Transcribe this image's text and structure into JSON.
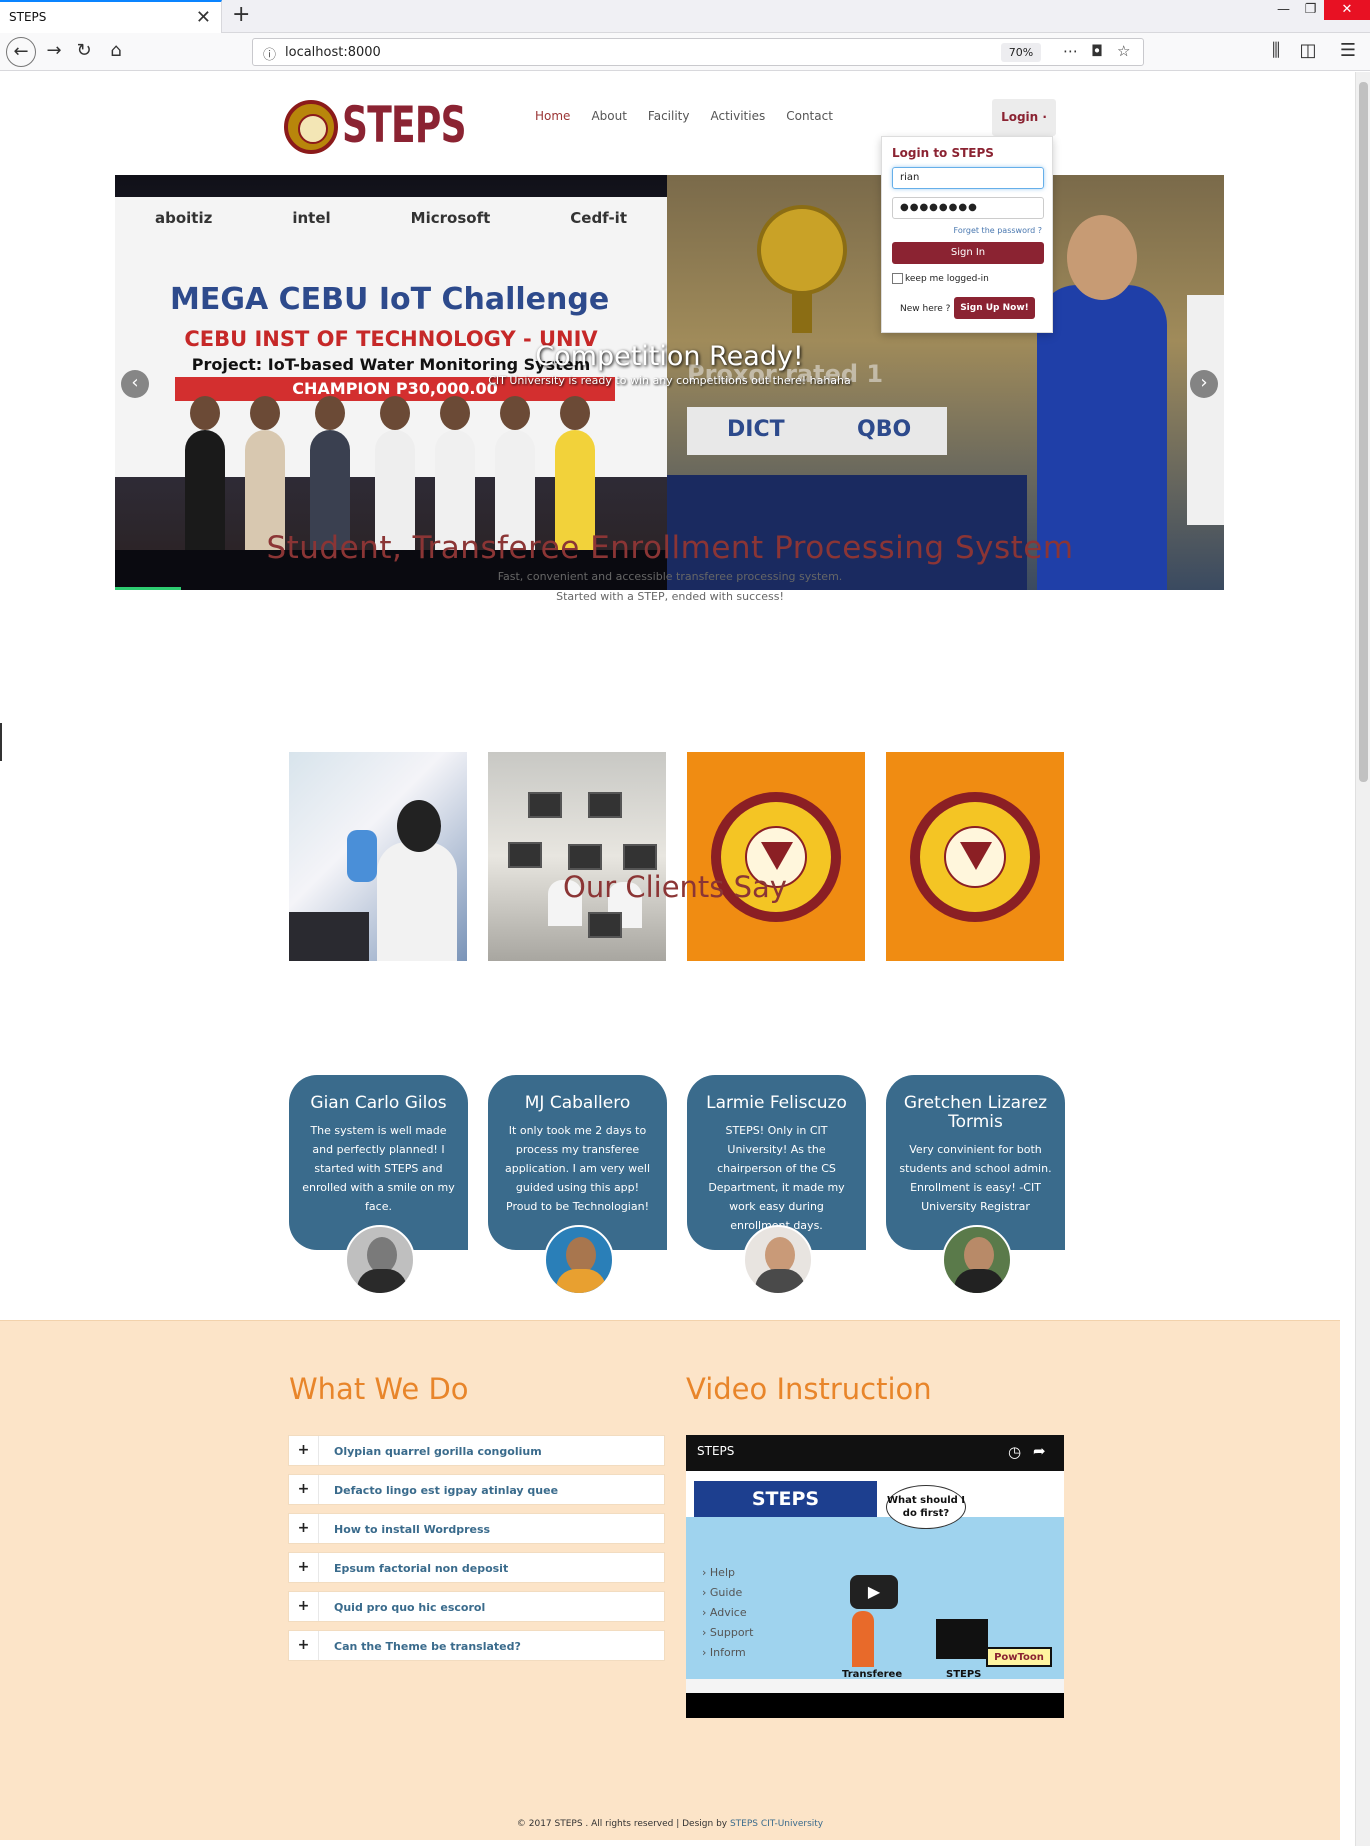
{
  "browser": {
    "tab_title": "STEPS",
    "tab_close": "✕",
    "new_tab": "+",
    "url": "localhost:8000",
    "zoom": "70%",
    "win_min": "—",
    "win_max": "❐",
    "win_close": "✕"
  },
  "header": {
    "logo_text": "STEPS",
    "nav": [
      "Home",
      "About",
      "Facility",
      "Activities",
      "Contact"
    ],
    "active_nav": "Home",
    "login_label": "Login ·"
  },
  "login": {
    "title": "Login to STEPS",
    "username_value": "rian",
    "password_value": "●●●●●●●●",
    "forgot": "Forget the password ?",
    "signin": "Sign In",
    "keep": "keep me logged-in",
    "new_here": "New here ?",
    "signup": "Sign Up Now!"
  },
  "slider": {
    "heading": "Competition Ready!",
    "subtext": "CIT University is ready to win any competitions out there! hahaha",
    "prev": "‹",
    "next": "›",
    "banner_sponsors": [
      "aboitiz",
      "intel",
      "Microsoft",
      "Cedf-it"
    ],
    "banner_iot": "MEGA CEBU IoT Challenge",
    "banner_school": "CEBU INST OF TECHNOLOGY - UNIV",
    "banner_project": "Project: IoT-based Water Monitoring System",
    "banner_champion": "CHAMPION          P30,000.00",
    "right_text": "Proxor rated 1",
    "right_logos": [
      "DICT",
      "QBO"
    ]
  },
  "intro": {
    "title": "Student, Transferee Enrollment Processing System",
    "line1": "Fast, convenient and accessible transferee processing system.",
    "line2": "Started with a STEP, ended with success!"
  },
  "clients": {
    "title": "Our Clients Say",
    "items": [
      {
        "name": "Gian Carlo Gilos",
        "text": "The system is well made and perfectly planned! I started with STEPS and enrolled with a smile on my face."
      },
      {
        "name": "MJ Caballero",
        "text": "It only took me 2 days to process my transferee application. I am very well guided using this app! Proud to be Technologian!"
      },
      {
        "name": "Larmie Feliscuzo",
        "text": "STEPS! Only in CIT University! As the chairperson of the CS Department, it made my work easy during enrollment days."
      },
      {
        "name": "Gretchen Lizarez Tormis",
        "text": "Very convinient for both students and school admin. Enrollment is easy! -CIT University Registrar"
      }
    ]
  },
  "what_we_do": {
    "title": "What We Do",
    "items": [
      "Olypian quarrel gorilla congolium",
      "Defacto lingo est igpay atinlay quee",
      "How to install Wordpress",
      "Epsum factorial non deposit",
      "Quid pro quo hic escorol",
      "Can the Theme be translated?"
    ],
    "plus": "+"
  },
  "video": {
    "title": "Video Instruction",
    "player_title": "STEPS",
    "ribbon": "STEPS",
    "bubble": "What should I do first?",
    "menu": [
      "Help",
      "Guide",
      "Advice",
      "Support",
      "Inform"
    ],
    "label_left": "Transferee",
    "label_right": "STEPS",
    "badge": "PowToon"
  },
  "footer": {
    "text": "© 2017 STEPS . All rights reserved | Design by ",
    "link": "STEPS CIT-University"
  },
  "colors": {
    "brand": "#8b2332",
    "accent_orange": "#e8852a",
    "card_blue": "#3a6b8c",
    "beige": "#fce4c8"
  }
}
